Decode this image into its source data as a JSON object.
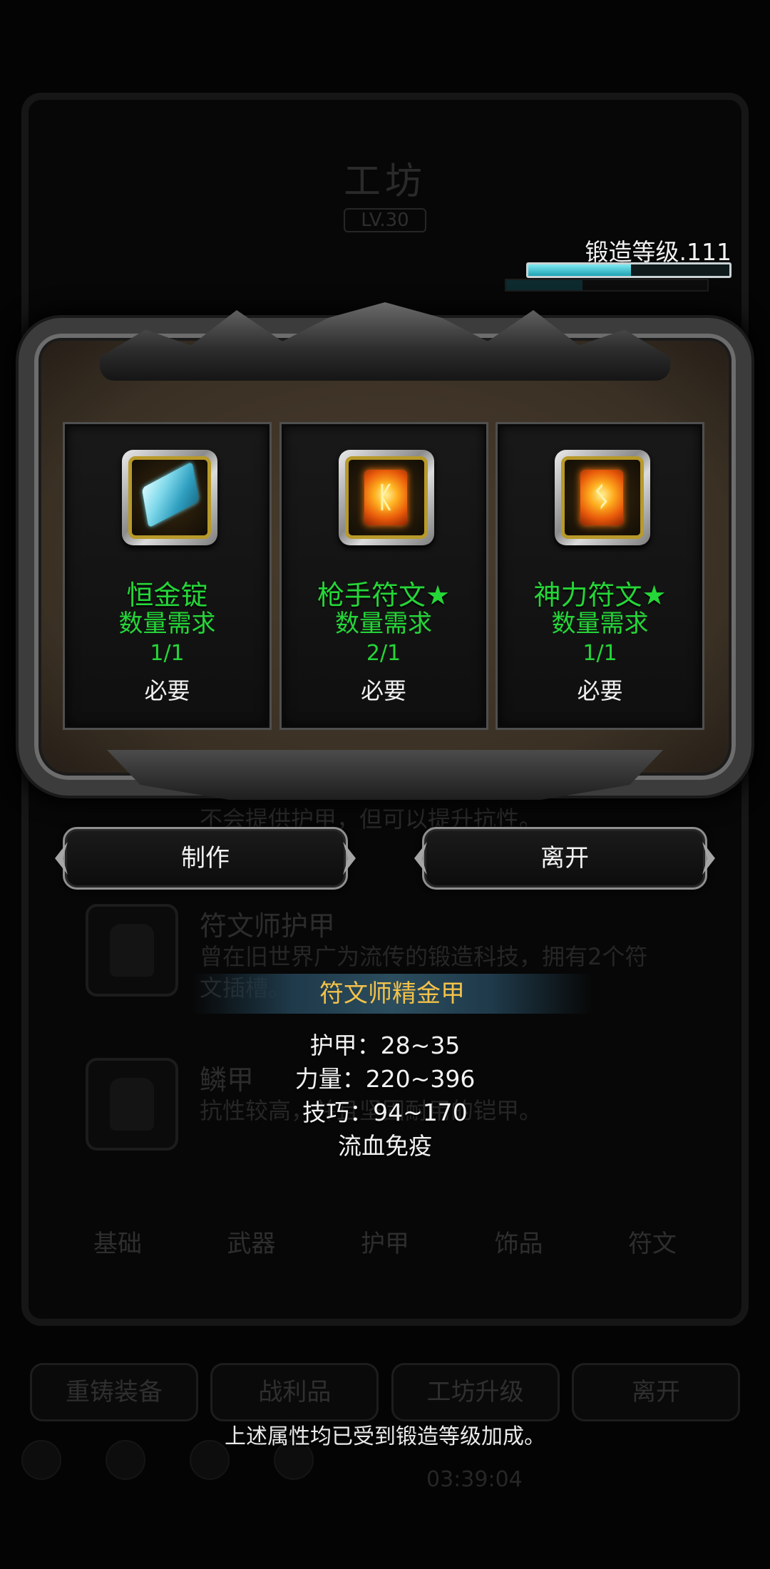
{
  "background": {
    "title": "工坊",
    "level": "LV.30",
    "list": [
      {
        "name": "",
        "desc": "不会提供护甲，但可以提升抗性。"
      },
      {
        "name": "符文师护甲",
        "desc": "曾在旧世界广为流传的锻造科技，拥有2个符文插槽。"
      },
      {
        "name": "鳞甲",
        "desc": "抗性较高，并且坚固耐用的铠甲。"
      }
    ],
    "tabs": [
      "基础",
      "武器",
      "护甲",
      "饰品",
      "符文"
    ],
    "buttons": [
      "重铸装备",
      "战利品",
      "工坊升级",
      "离开"
    ],
    "time": "03:39:04"
  },
  "forge": {
    "label": "锻造等级.111",
    "progress": 0.51
  },
  "materials": [
    {
      "name": "恒金锭",
      "requirement_label": "数量需求",
      "count": "1/1",
      "required_label": "必要",
      "icon": "ingot-icon"
    },
    {
      "name": "枪手符文★",
      "requirement_label": "数量需求",
      "count": "2/1",
      "required_label": "必要",
      "icon": "gunner-rune-icon",
      "glyph": "ᛕ"
    },
    {
      "name": "神力符文★",
      "requirement_label": "数量需求",
      "count": "1/1",
      "required_label": "必要",
      "icon": "divine-rune-icon",
      "glyph": "ᛊ"
    }
  ],
  "actions": {
    "make": "制作",
    "leave": "离开"
  },
  "tooltip": {
    "item_name": "符文师精金甲",
    "stats": [
      "护甲：28~35",
      "力量：220~396",
      "技巧：94~170",
      "流血免疫"
    ],
    "note": "上述属性均已受到锻造等级加成。"
  },
  "colors": {
    "material_text": "#25d638",
    "item_name": "#f3c24a",
    "progress": "#3fc4d2"
  }
}
